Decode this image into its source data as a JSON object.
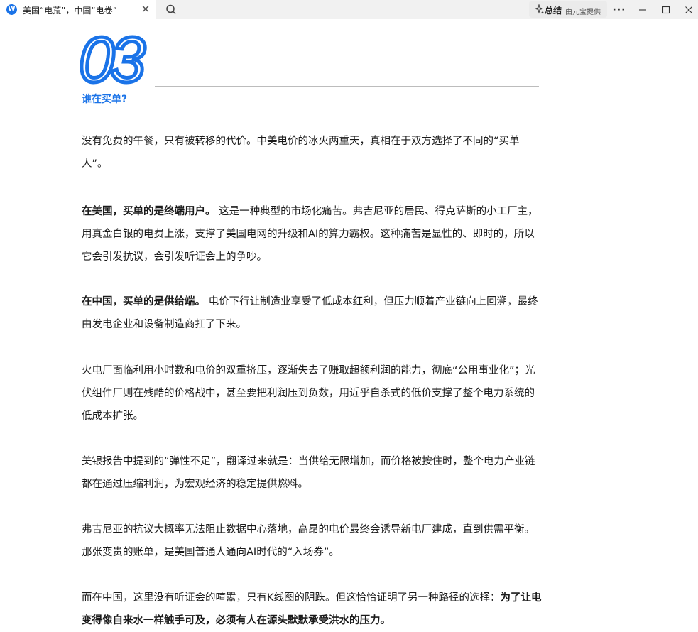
{
  "tab": {
    "favicon": "W",
    "title": "美国“电荒”，中国“电卷”",
    "close": "✕"
  },
  "toolbar": {
    "search_icon": "search-icon",
    "summary_label": "总结",
    "summary_sub": "由元宝提供",
    "more": "···"
  },
  "article": {
    "section_number": "03",
    "section_title": "谁在买单?",
    "p1": "没有免费的午餐，只有被转移的代价。中美电价的冰火两重天，真相在于双方选择了不同的“买单人”。",
    "p2_bold": "在美国，买单的是终端用户。",
    "p2_text": " 这是一种典型的市场化痛苦。弗吉尼亚的居民、得克萨斯的小工厂主，用真金白银的电费上涨，支撑了美国电网的升级和AI的算力霸权。这种痛苦是显性的、即时的，所以它会引发抗议，会引发听证会上的争吵。",
    "p3_bold": "在中国，买单的是供给端。",
    "p3_text": " 电价下行让制造业享受了低成本红利，但压力顺着产业链向上回溯，最终由发电企业和设备制造商扛了下来。",
    "p4": "火电厂面临利用小时数和电价的双重挤压，逐渐失去了赚取超额利润的能力，彻底“公用事业化”；光伏组件厂则在残酷的价格战中，甚至要把利润压到负数，用近乎自杀式的低价支撑了整个电力系统的低成本扩张。",
    "p5": "美银报告中提到的“弹性不足”，翻译过来就是：当供给无限增加，而价格被按住时，整个电力产业链都在通过压缩利润，为宏观经济的稳定提供燃料。",
    "p6": "弗吉尼亚的抗议大概率无法阻止数据中心落地，高昂的电价最终会诱导新电厂建成，直到供需平衡。那张变贵的账单，是美国普通人通向AI时代的“入场券”。",
    "p7_text": "而在中国，这里没有听证会的喧嚣，只有K线图的阴跌。但这恰恰证明了另一种路径的选择：",
    "p7_bold": "为了让电变得像自来水一样触手可及，必须有人在源头默默承受洪水的压力。"
  },
  "colors": {
    "accent": "#1a73e8",
    "titlebar": "#f1f1f1"
  }
}
